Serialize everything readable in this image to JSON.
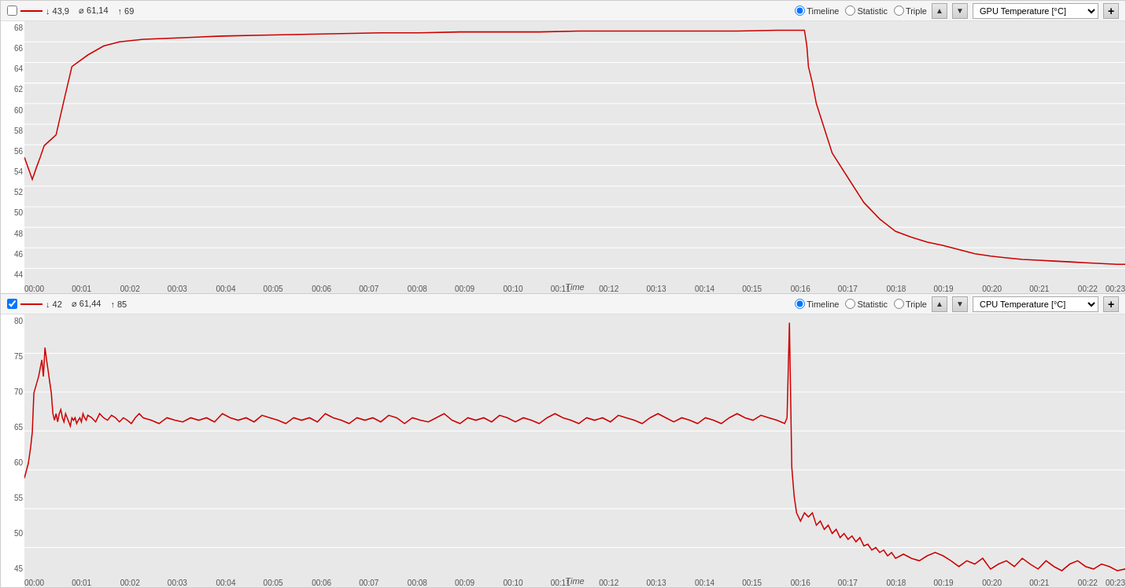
{
  "charts": [
    {
      "id": "gpu-temp",
      "legend": {
        "checked": false,
        "min_label": "↓ 43,9",
        "avg_label": "⌀ 61,14",
        "max_label": "↑ 69"
      },
      "controls": {
        "timeline_label": "Timeline",
        "statistic_label": "Statistic",
        "triple_label": "Triple",
        "timeline_checked": true,
        "statistic_checked": false,
        "triple_checked": false,
        "dropdown_value": "GPU Temperature [°C]",
        "add_label": "+"
      },
      "y_axis": [
        "68",
        "66",
        "64",
        "62",
        "60",
        "58",
        "56",
        "54",
        "52",
        "50",
        "48",
        "46",
        "44"
      ],
      "x_labels": [
        "00:00",
        "00:01",
        "00:02",
        "00:03",
        "00:04",
        "00:05",
        "00:06",
        "00:07",
        "00:08",
        "00:09",
        "00:10",
        "00:11",
        "00:12",
        "00:13",
        "00:14",
        "00:15",
        "00:16",
        "00:17",
        "00:18",
        "00:19",
        "00:20",
        "00:21",
        "00:22",
        "00:23"
      ],
      "x_title": "Time"
    },
    {
      "id": "cpu-temp",
      "legend": {
        "checked": true,
        "min_label": "↓ 42",
        "avg_label": "⌀ 61,44",
        "max_label": "↑ 85"
      },
      "controls": {
        "timeline_label": "Timeline",
        "statistic_label": "Statistic",
        "triple_label": "Triple",
        "timeline_checked": true,
        "statistic_checked": false,
        "triple_checked": false,
        "dropdown_value": "CPU Temperature [°C]",
        "add_label": "+"
      },
      "y_axis": [
        "80",
        "75",
        "70",
        "65",
        "60",
        "55",
        "50",
        "45"
      ],
      "x_labels": [
        "00:00",
        "00:01",
        "00:02",
        "00:03",
        "00:04",
        "00:05",
        "00:06",
        "00:07",
        "00:08",
        "00:09",
        "00:10",
        "00:11",
        "00:12",
        "00:13",
        "00:14",
        "00:15",
        "00:16",
        "00:17",
        "00:18",
        "00:19",
        "00:20",
        "00:21",
        "00:22",
        "00:23"
      ],
      "x_title": "Time"
    }
  ],
  "colors": {
    "line": "#cc0000",
    "grid_bg": "#e8e8e8",
    "grid_line": "#ffffff"
  }
}
